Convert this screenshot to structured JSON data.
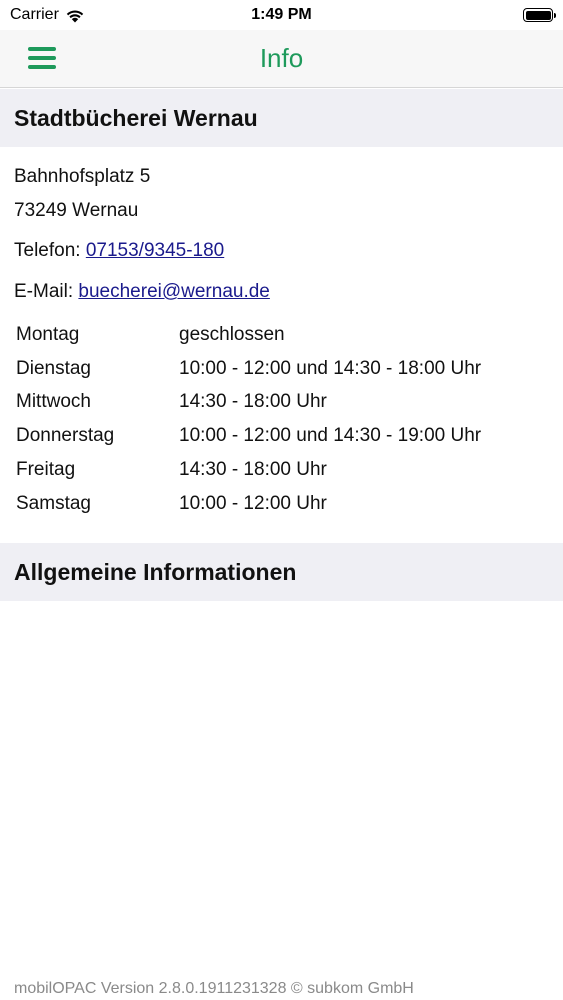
{
  "status_bar": {
    "carrier": "Carrier",
    "time": "1:49 PM",
    "icons": [
      "wifi-icon",
      "battery-icon"
    ]
  },
  "nav": {
    "title": "Info",
    "menu_icon": "hamburger-menu-icon",
    "accent_color": "#1e9a5b"
  },
  "library": {
    "name": "Stadtbücherei Wernau",
    "street": "Bahnhofsplatz 5",
    "city": "73249 Wernau",
    "phone_label": "Telefon: ",
    "phone": "07153/9345-180",
    "email_label": "E-Mail: ",
    "email": "buecherei@wernau.de"
  },
  "hours": [
    {
      "day": "Montag",
      "time": "geschlossen"
    },
    {
      "day": "Dienstag",
      "time": "10:00 - 12:00 und 14:30 - 18:00 Uhr"
    },
    {
      "day": "Mittwoch",
      "time": "14:30 - 18:00 Uhr"
    },
    {
      "day": "Donnerstag",
      "time": "10:00 - 12:00 und 14:30 - 19:00 Uhr"
    },
    {
      "day": "Freitag",
      "time": "14:30 - 18:00 Uhr"
    },
    {
      "day": "Samstag",
      "time": "10:00 - 12:00 Uhr"
    }
  ],
  "general": {
    "title": "Allgemeine Informationen"
  },
  "footer": {
    "version_text": "mobilOPAC Version 2.8.0.1911231328 © subkom GmbH"
  }
}
